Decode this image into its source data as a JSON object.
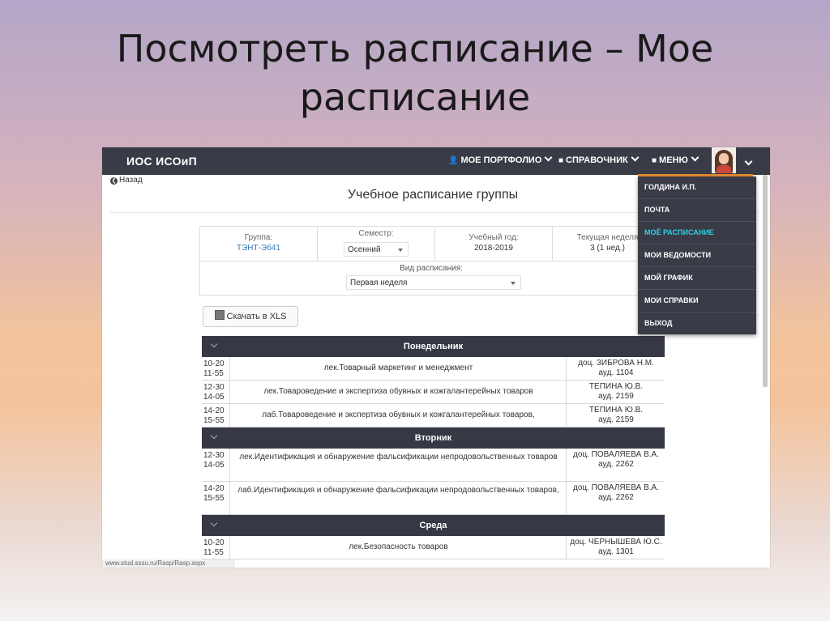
{
  "slide": {
    "title_line1": "Посмотреть расписание – Мое",
    "title_line2": "расписание"
  },
  "navbar": {
    "brand": "ИОС ИСОиП",
    "portfolio": "МОЕ ПОРТФОЛИО",
    "reference": "СПРАВОЧНИК",
    "menu": "МЕНЮ"
  },
  "dropdown": {
    "items": [
      "ГОЛДИНА И.П.",
      "ПОЧТА",
      "МОЁ РАСПИСАНИЕ",
      "МОИ ВЕДОМОСТИ",
      "МОЙ ГРАФИК",
      "МОИ СПРАВКИ",
      "ВЫХОД"
    ],
    "active_index": 2
  },
  "page": {
    "back": "Назад",
    "heading": "Учебное расписание группы",
    "download_button": "Скачать в XLS",
    "status_url": "www.stud.sssu.ru/Rasp/Rasp.aspx"
  },
  "info": {
    "group_label": "Группа:",
    "group_value": "ТЭНТ-Эб41",
    "semester_label": "Семестр:",
    "semester_value": "Осенний",
    "year_label": "Учебный год:",
    "year_value": "2018-2019",
    "week_label": "Текущая неделя",
    "week_value": "3 (1 нед.)",
    "type_label": "Вид расписания:",
    "type_value": "Первая неделя"
  },
  "schedule": {
    "days": [
      {
        "name": "Понедельник",
        "lessons": [
          {
            "start": "10-20",
            "end": "11-55",
            "subject": "лек.Товарный маркетинг и менеджмент",
            "teacher": "доц. ЗИБРОВА Н.М.",
            "room": "ауд. 1104"
          },
          {
            "start": "12-30",
            "end": "14-05",
            "subject": "лек.Товароведение и экспертиза обувных и кожгалантерейных товаров",
            "teacher": "ТЕПИНА Ю.В.",
            "room": "ауд. 2159"
          },
          {
            "start": "14-20",
            "end": "15-55",
            "subject": "лаб.Товароведение и экспертиза обувных и кожгалантерейных товаров,",
            "teacher": "ТЕПИНА Ю.В.",
            "room": "ауд. 2159"
          }
        ]
      },
      {
        "name": "Вторник",
        "lessons": [
          {
            "start": "12-30",
            "end": "14-05",
            "subject": "лек.Идентификация и обнаружение фальсификации непродовольственных товаров",
            "teacher": "доц. ПОВАЛЯЕВА В.А.",
            "room": "ауд. 2262"
          },
          {
            "start": "14-20",
            "end": "15-55",
            "subject": "лаб.Идентификация и обнаружение фальсификации непродовольственных товаров,",
            "teacher": "доц. ПОВАЛЯЕВА В.А.",
            "room": "ауд. 2262"
          }
        ]
      },
      {
        "name": "Среда",
        "lessons": [
          {
            "start": "10-20",
            "end": "11-55",
            "subject": "лек.Безопасность товаров",
            "teacher": "доц. ЧЕРНЫШЕВА Ю.С.",
            "room": "ауд. 1301"
          }
        ]
      }
    ]
  }
}
